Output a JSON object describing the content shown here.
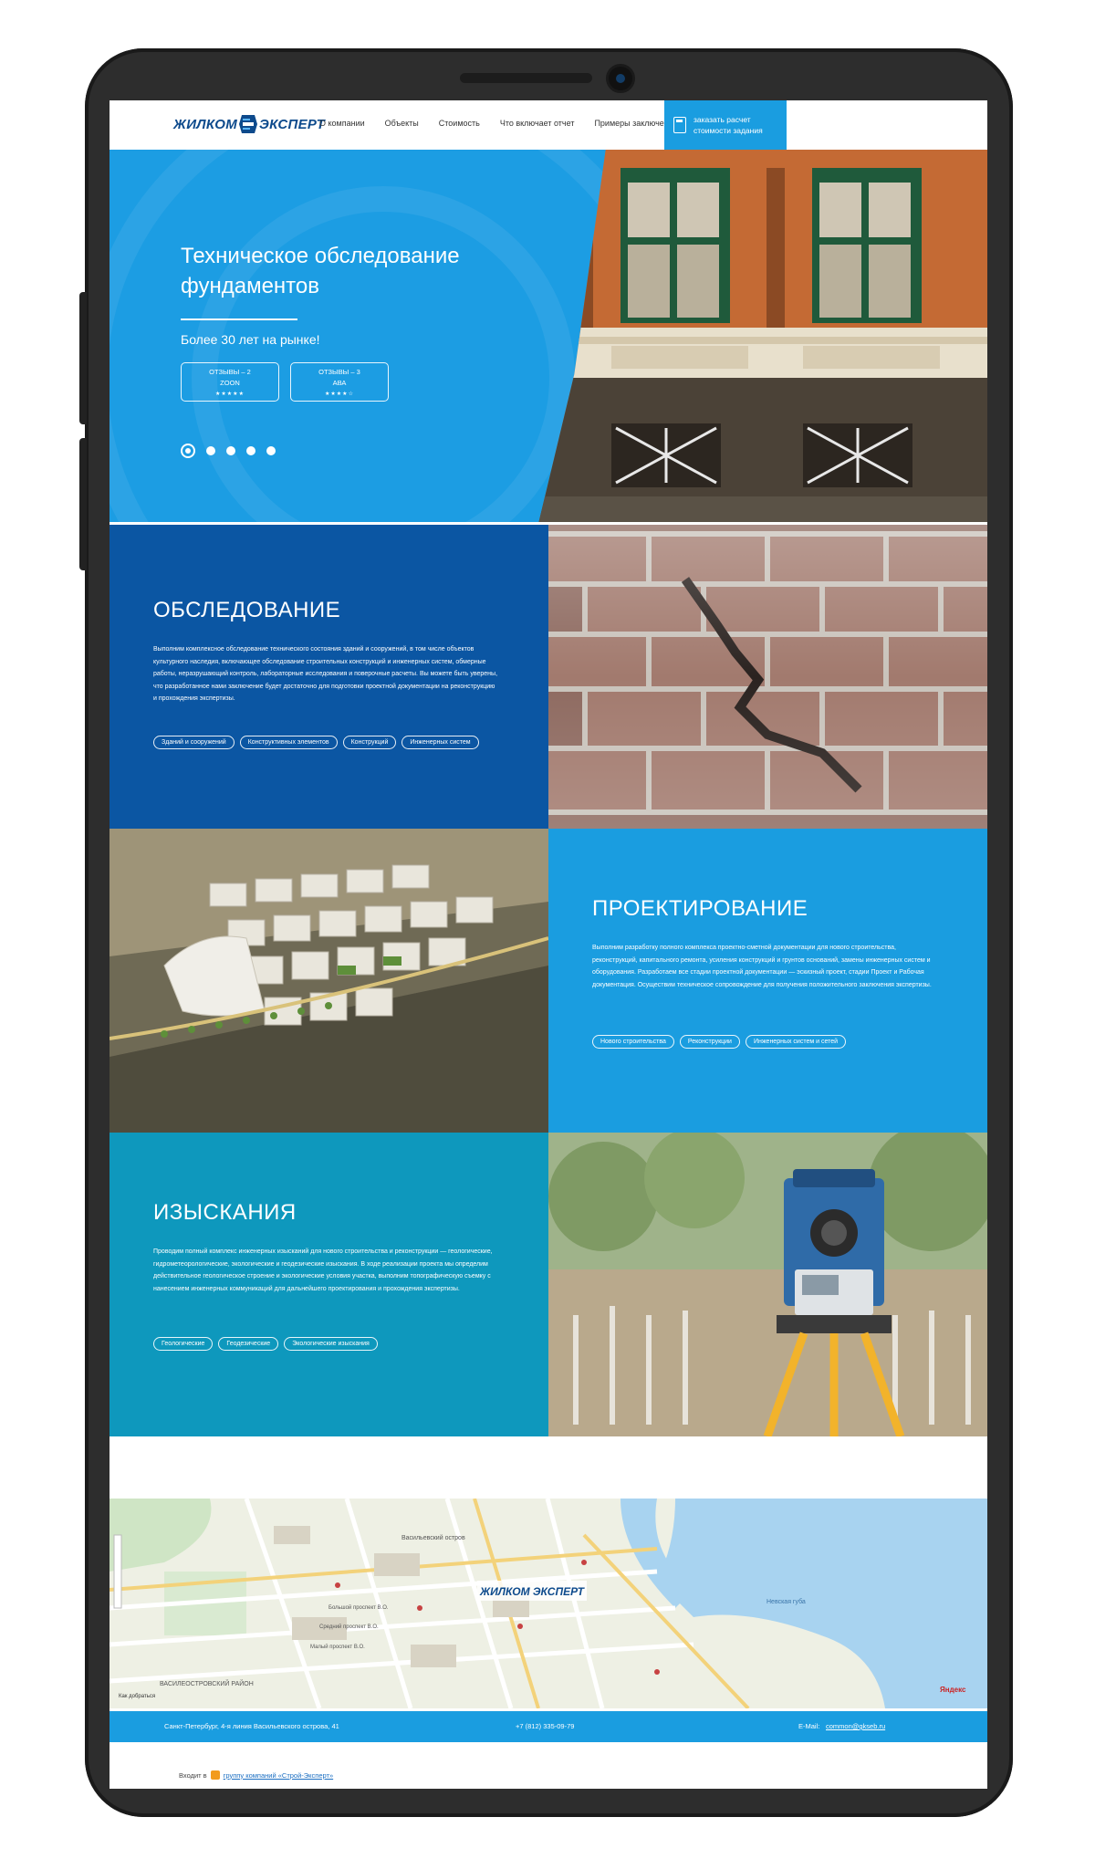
{
  "header": {
    "logo_left": "ЖИЛКОМ",
    "logo_right": "ЭКСПЕРТ",
    "nav": [
      "О компании",
      "Объекты",
      "Стоимость",
      "Что включает отчет",
      "Примеры заключений"
    ],
    "cta_label": "заказать расчет стоимости задания"
  },
  "hero": {
    "title": "Техническое обследование фундаментов",
    "subtitle": "Более 30 лет на рынке!",
    "reviews": [
      {
        "line1": "ОТЗЫВЫ – 2",
        "line2": "ZOON",
        "stars": "★★★★★"
      },
      {
        "line1": "ОТЗЫВЫ – 3",
        "line2": "АВА",
        "stars": "★★★★☆"
      }
    ],
    "slides_count": 5
  },
  "services": [
    {
      "title": "ОБСЛЕДОВАНИЕ",
      "text": "Выполним комплексное обследование технического состояния зданий и сооружений, в том числе объектов культурного наследия, включающее обследование строительных конструкций и инженерных систем, обмерные работы, неразрушающий контроль, лабораторные исследования и поверочные расчеты. Вы можете быть уверены, что разработанное нами заключение будет достаточно для подготовки проектной документации на реконструкцию и прохождения экспертизы.",
      "tags": [
        "Зданий и сооружений",
        "Конструктивных элементов",
        "Конструкций",
        "Инженерных систем"
      ],
      "color": "#0b56a3"
    },
    {
      "title": "ПРОЕКТИРОВАНИЕ",
      "text": "Выполним разработку полного комплекса проектно-сметной документации для нового строительства, реконструкций, капитального ремонта, усиления конструкций и грунтов оснований, замены инженерных систем и оборудования. Разработаем все стадии проектной документации — эскизный проект, стадии Проект и Рабочая документация. Осуществим техническое сопровождение для получения положительного заключения экспертизы.",
      "tags": [
        "Нового строительства",
        "Реконструкции",
        "Инженерных систем и сетей"
      ],
      "color": "#1a9de0"
    },
    {
      "title": "ИЗЫСКАНИЯ",
      "text": "Проводим полный комплекс инженерных изысканий для нового строительства и реконструкции — геологические, гидрометеорологические, экологические и геодезические изыскания. В ходе реализации проекта мы определим действительное геологическое строение и экологические условия участка, выполним топографическую съемку с нанесением инженерных коммуникаций для дальнейшего проектирования и прохождения экспертизы.",
      "tags": [
        "Геологические",
        "Геодезические",
        "Экологические изыскания"
      ],
      "color": "#0e98bd"
    }
  ],
  "map": {
    "district": "ВАСИЛЕОСТРОВСКИЙ РАЙОН",
    "streets": [
      "Малый проспект В.О.",
      "Средний проспект В.О.",
      "Большой проспект В.О.",
      "Невская губа",
      "Васильевский остров"
    ],
    "brand": "Яндекс",
    "route_link": "Как добраться"
  },
  "footer": {
    "address": "Санкт-Петербург, 4-я линия Васильевского острова, 41",
    "phone": "+7 (812) 335-09-79",
    "email_label": "E-Mail:",
    "email": "common@gkseb.ru"
  },
  "credits": {
    "prefix": "Входит в",
    "link": "группу компаний «Строй-Эксперт»"
  }
}
